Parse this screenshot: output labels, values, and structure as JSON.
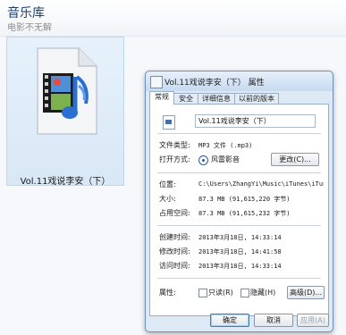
{
  "library": {
    "title": "音乐库",
    "subtitle": "电影不无解"
  },
  "file": {
    "name": "Vol.11戏说李安（下）",
    "icon": "audio-file-icon"
  },
  "dialog": {
    "title": "Vol.11戏说李安（下） 属性",
    "tabs": [
      "常规",
      "安全",
      "详细信息",
      "以前的版本"
    ],
    "filename": "Vol.11戏说李安（下）",
    "type_label": "文件类型:",
    "type_value": "MP3 文件 (.mp3)",
    "open_label": "打开方式:",
    "open_value": "风雷影音",
    "change_button": "更改(C)...",
    "location_label": "位置:",
    "location_value": "C:\\Users\\ZhangYi\\Music\\iTunes\\iTunes Medi",
    "size_label": "大小:",
    "size_value": "87.3 MB (91,615,220 字节)",
    "disk_label": "占用空间:",
    "disk_value": "87.3 MB (91,615,232 字节)",
    "created_label": "创建时间:",
    "created_value": "2013年3月18日, 14:33:14",
    "modified_label": "修改时间:",
    "modified_value": "2013年3月18日, 14:41:58",
    "accessed_label": "访问时间:",
    "accessed_value": "2013年3月18日, 14:33:14",
    "attr_label": "属性:",
    "readonly_label": "只读(R)",
    "hidden_label": "隐藏(H)",
    "advanced_button": "高级(D)...",
    "ok_button": "确定",
    "cancel_button": "取消",
    "apply_button": "应用(A)"
  }
}
